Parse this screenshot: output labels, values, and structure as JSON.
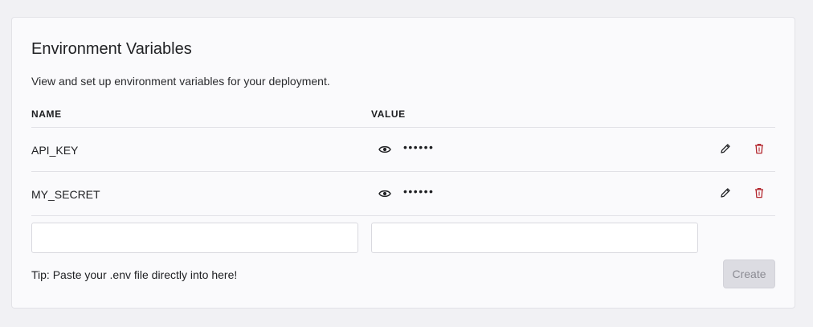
{
  "panel": {
    "title": "Environment Variables",
    "description": "View and set up environment variables for your deployment."
  },
  "table": {
    "headers": {
      "name": "NAME",
      "value": "VALUE"
    },
    "rows": [
      {
        "name": "API_KEY",
        "masked_value": "••••••"
      },
      {
        "name": "MY_SECRET",
        "masked_value": "••••••"
      }
    ]
  },
  "form": {
    "name_input": {
      "value": "",
      "placeholder": ""
    },
    "value_input": {
      "value": "",
      "placeholder": ""
    },
    "tip": "Tip: Paste your .env file directly into here!",
    "create_label": "Create"
  },
  "icons": {
    "show_value": "eye-icon",
    "edit": "pencil-icon",
    "delete": "trash-icon"
  },
  "colors": {
    "delete_icon": "#b3262d",
    "create_disabled_bg": "#dcdce2",
    "create_disabled_text": "#8b8b93"
  }
}
